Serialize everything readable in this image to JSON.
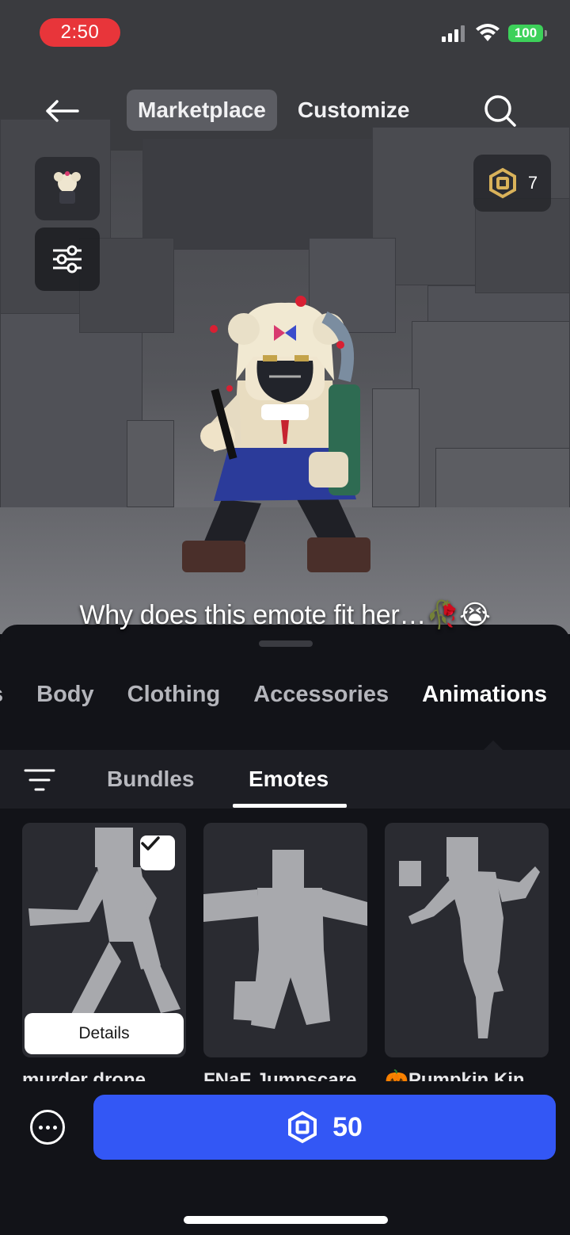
{
  "status_bar": {
    "time": "2:50",
    "battery": "100"
  },
  "nav": {
    "tabs": [
      "Marketplace",
      "Customize"
    ],
    "active_tab": 0
  },
  "robux_balance": "7",
  "caption": "Why does this emote fit her…🥀😭",
  "categories": {
    "items": [
      "s",
      "Body",
      "Clothing",
      "Accessories",
      "Animations"
    ],
    "active": 4
  },
  "subtabs": {
    "items": [
      "Bundles",
      "Emotes"
    ],
    "active": 1
  },
  "items": [
    {
      "name": "murder drone",
      "selected": true,
      "details_label": "Details"
    },
    {
      "name": "FNaF Jumpscare",
      "selected": false
    },
    {
      "name": "🎃Pumpkin Kin",
      "selected": false
    }
  ],
  "buy": {
    "price": "50"
  },
  "colors": {
    "accent_blue": "#3357f5",
    "time_pill": "#e8353a",
    "battery_green": "#3dd15a"
  },
  "icons": [
    "back-arrow-icon",
    "search-icon",
    "sliders-icon",
    "robux-icon",
    "filter-icon",
    "check-icon",
    "more-icon"
  ]
}
